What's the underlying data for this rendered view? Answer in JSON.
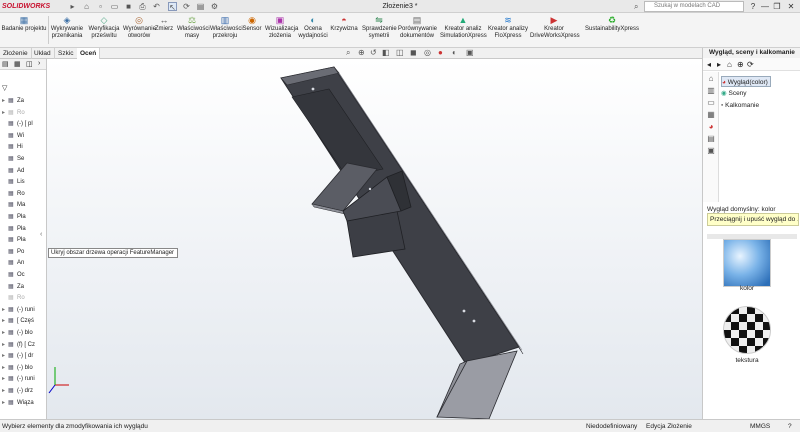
{
  "titlebar": {
    "logo": "SOLIDWORKS",
    "title": "Złożenie3 *",
    "search_placeholder": "Szukaj w modelach CAD",
    "controls": [
      "?",
      "—",
      "❐",
      "✕"
    ]
  },
  "ribbon": {
    "first": {
      "label": "Badanie projektu",
      "icon": "design-study-icon"
    },
    "items": [
      {
        "label": "Wykrywanie przenikania",
        "icon": "interference-detection-icon"
      },
      {
        "label": "Weryfikacja prześwitu",
        "icon": "clearance-verification-icon"
      },
      {
        "label": "Wyrównanie otworów",
        "icon": "hole-alignment-icon"
      },
      {
        "label": "Zmierz",
        "icon": "measure-icon"
      },
      {
        "label": "Właściwości masy",
        "icon": "mass-properties-icon"
      },
      {
        "label": "Właściwości przekroju",
        "icon": "section-properties-icon"
      },
      {
        "label": "Sensor",
        "icon": "sensor-icon"
      },
      {
        "label": "Wizualizacja złożenia",
        "icon": "assembly-visualization-icon"
      },
      {
        "label": "Ocena wydajności",
        "icon": "performance-evaluation-icon"
      },
      {
        "label": "Krzywizna",
        "icon": "curvature-icon"
      },
      {
        "label": "Sprawdzenie symetrii",
        "icon": "symmetry-check-icon"
      },
      {
        "label": "Porównywanie dokumentów",
        "icon": "compare-documents-icon"
      },
      {
        "label": "Kreator analiz SimulationXpress",
        "icon": "simulationxpress-icon"
      },
      {
        "label": "Kreator analizy FloXpress",
        "icon": "floxpress-icon"
      },
      {
        "label": "Kreator DriveWorksXpress",
        "icon": "driveworksxpress-icon"
      },
      {
        "label": "SustainabilityXpress",
        "icon": "sustainabilityxpress-icon"
      }
    ]
  },
  "tabs": [
    "Złożenie",
    "Układ",
    "Szkic",
    "Oceń"
  ],
  "active_tab": "Oceń",
  "feature_tree": [
    {
      "label": "Za",
      "dim": false
    },
    {
      "label": "Ro",
      "dim": true
    },
    {
      "label": "(-) [ pl",
      "dim": false
    },
    {
      "label": "Wi",
      "dim": false
    },
    {
      "label": "Hi",
      "dim": false
    },
    {
      "label": "Se",
      "dim": false
    },
    {
      "label": "Ad",
      "dim": false
    },
    {
      "label": "Lis",
      "dim": false
    },
    {
      "label": "Ro",
      "dim": false
    },
    {
      "label": "Ma",
      "dim": false
    },
    {
      "label": "Pła",
      "dim": false
    },
    {
      "label": "Pła",
      "dim": false
    },
    {
      "label": "Pła",
      "dim": false
    },
    {
      "label": "Po",
      "dim": false
    },
    {
      "label": "An",
      "dim": false
    },
    {
      "label": "Oc",
      "dim": false
    },
    {
      "label": "Za",
      "dim": false
    },
    {
      "label": "Ro",
      "dim": true
    },
    {
      "label": "(-) runi",
      "dim": false
    },
    {
      "label": "[ Częś",
      "dim": false
    },
    {
      "label": "(-) blo",
      "dim": false
    },
    {
      "label": "(f) [ Cz",
      "dim": false
    },
    {
      "label": "(-) [ dr",
      "dim": false
    },
    {
      "label": "(-) blo",
      "dim": false
    },
    {
      "label": "(-) runi",
      "dim": false
    },
    {
      "label": "(-) drz",
      "dim": false
    },
    {
      "label": "Wiąza",
      "dim": false
    }
  ],
  "tooltip": "Ukryj obszar drzewa operacji FeatureManager",
  "task_pane": {
    "title": "Wygląd, sceny i kalkomanie",
    "tree": [
      "Wygląd(color)",
      "Sceny",
      "Kalkomanie"
    ],
    "default_label": "Wygląd domyślny: kolor",
    "hint": "Przeciągnij i upuść wygląd do ...",
    "swatches": [
      "kolor",
      "tekstura"
    ]
  },
  "status": {
    "message": "Wybierz elementy dla zmodyfikowania ich wyglądu",
    "state": "Niedodefiniowany",
    "mode": "Edycja Złożenie",
    "units": "MMGS"
  },
  "colors": {
    "accent": "#c8102e",
    "model": "#4a4b52",
    "tooltip_bg": "#ffffc8"
  }
}
